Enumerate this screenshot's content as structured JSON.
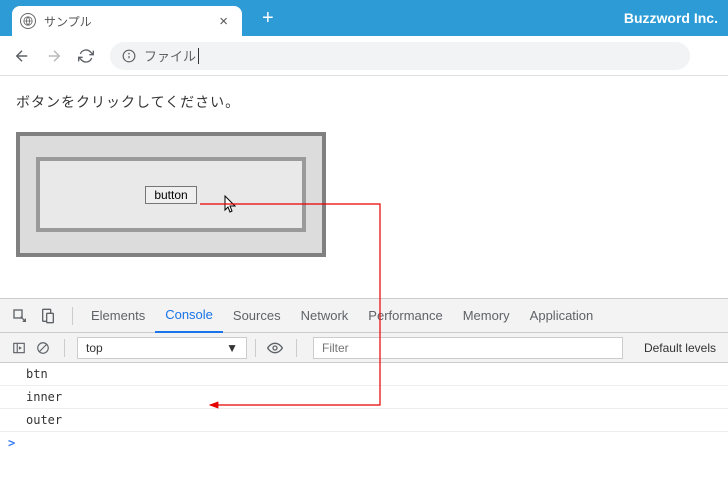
{
  "brand": "Buzzword Inc.",
  "tab": {
    "title": "サンプル"
  },
  "address": {
    "scheme_label": "ファイル"
  },
  "page": {
    "instruction": "ボタンをクリックしてください。",
    "button_label": "button"
  },
  "devtools": {
    "tabs": {
      "elements": "Elements",
      "console": "Console",
      "sources": "Sources",
      "network": "Network",
      "performance": "Performance",
      "memory": "Memory",
      "application": "Application"
    },
    "context": "top",
    "filter_placeholder": "Filter",
    "levels_label": "Default levels",
    "log": [
      "btn",
      "inner",
      "outer"
    ],
    "prompt": ">"
  }
}
